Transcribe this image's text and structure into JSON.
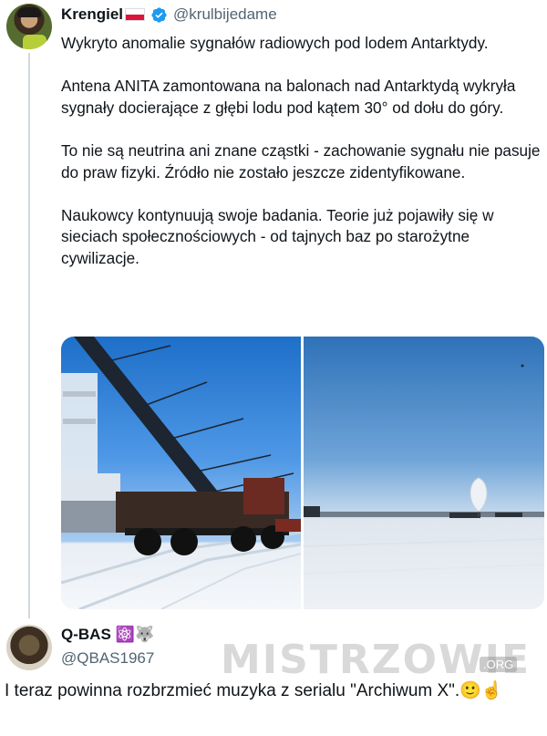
{
  "tweet": {
    "author_name": "Krengiel",
    "handle": "@krulbijedame",
    "paragraphs": [
      "Wykryto anomalie sygnałów radiowych pod lodem Antarktydy.",
      "Antena ANITA zamontowana na balonach nad Antarktydą wykryła sygnały docierające z głębi lodu pod kątem 30° od dołu do góry.",
      "To nie są neutrina ani znane cząstki - zachowanie sygnału nie pasuje do praw fizyki. Źródło nie zostało jeszcze zidentyfikowane.",
      "Naukowcy kontynuują swoje badania. Teorie już pojawiły się w sieciach społecznościowych - od tajnych baz po starożytne cywilizacje."
    ]
  },
  "reply": {
    "author_name": "Q-BAS",
    "name_emojis": "⚛️🐺",
    "handle": "@QBAS1967",
    "text": "I teraz powinna rozbrzmieć muzyka z serialu \"Archiwum X\".",
    "trailing_emojis": "🙂☝️"
  },
  "watermark": {
    "text": "MISTRZOWIE",
    "suffix": ".ORG"
  },
  "colors": {
    "verified_badge": "#1d9bf0",
    "handle_gray": "#536471",
    "thread_line": "#cfd9de",
    "sky_blue": "#3d87d8",
    "ice_white": "#f1f4f8"
  },
  "icons": [
    "verified-badge-icon",
    "poland-flag-icon",
    "atom-icon",
    "wolf-icon"
  ]
}
